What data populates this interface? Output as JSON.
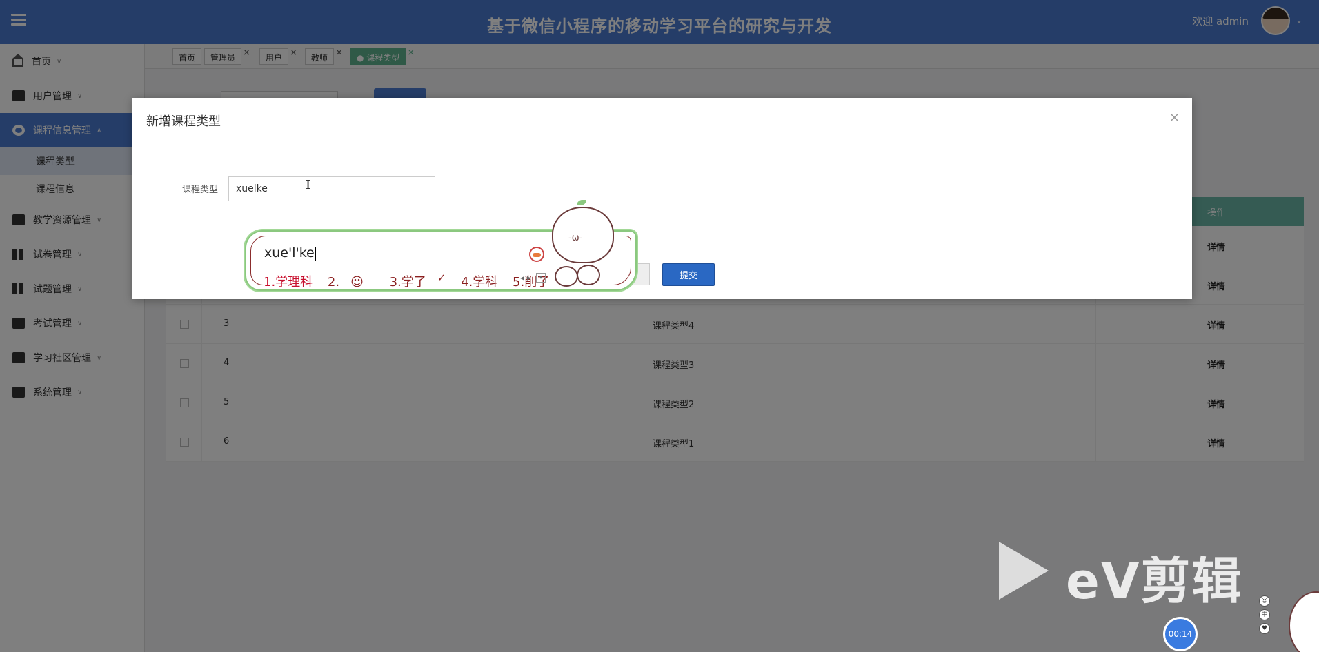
{
  "header": {
    "title": "基于微信小程序的移动学习平台的研究与开发",
    "welcome": "欢迎 admin"
  },
  "sidebar": {
    "items": [
      {
        "label": "首页",
        "icon": "home-icon"
      },
      {
        "label": "用户管理",
        "icon": "user-icon"
      },
      {
        "label": "课程信息管理",
        "icon": "course-icon",
        "active": true,
        "children": [
          {
            "label": "课程类型",
            "current": true
          },
          {
            "label": "课程信息"
          }
        ]
      },
      {
        "label": "教学资源管理",
        "icon": "resource-icon"
      },
      {
        "label": "试卷管理",
        "icon": "paper-icon"
      },
      {
        "label": "试题管理",
        "icon": "question-icon"
      },
      {
        "label": "考试管理",
        "icon": "exam-icon"
      },
      {
        "label": "学习社区管理",
        "icon": "community-icon"
      },
      {
        "label": "系统管理",
        "icon": "system-icon"
      }
    ]
  },
  "tabs": [
    {
      "label": "首页"
    },
    {
      "label": "管理员"
    },
    {
      "label": "用户"
    },
    {
      "label": "教师"
    },
    {
      "label": "课程类型",
      "active": true
    }
  ],
  "table": {
    "op_header": "操作",
    "rows": [
      {
        "num": "",
        "name": "",
        "detail": "详情"
      },
      {
        "num": "",
        "name": "",
        "detail": "详情"
      },
      {
        "num": "3",
        "name": "课程类型4",
        "detail": "详情"
      },
      {
        "num": "4",
        "name": "课程类型3",
        "detail": "详情"
      },
      {
        "num": "5",
        "name": "课程类型2",
        "detail": "详情"
      },
      {
        "num": "6",
        "name": "课程类型1",
        "detail": "详情"
      }
    ]
  },
  "modal": {
    "title": "新增课程类型",
    "close": "×",
    "field_label": "课程类型",
    "field_value": "xuelke",
    "submit_label": "提交"
  },
  "ime": {
    "composition": "xue'l'ke",
    "candidates": [
      "1.学理科",
      "2.",
      "3.学了",
      "4.学科",
      "5.削了"
    ]
  },
  "watermark": {
    "text": "eV剪辑",
    "timer": "00:14"
  },
  "colors": {
    "header": "#4a7bd1",
    "active_tab": "#5fb38f",
    "table_head": "#6ab7a6",
    "submit": "#2a68c3"
  }
}
